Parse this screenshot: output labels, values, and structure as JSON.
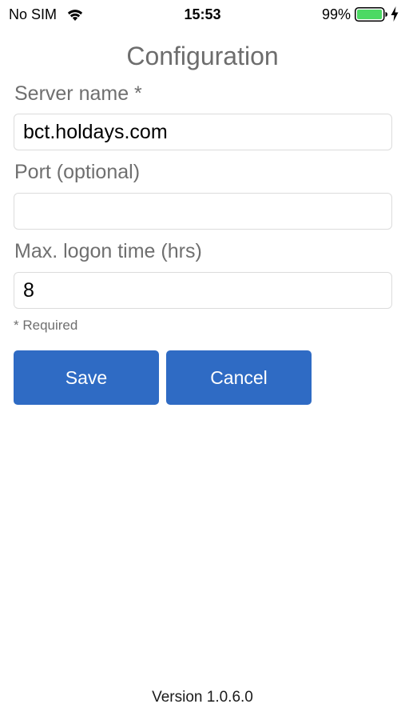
{
  "status_bar": {
    "carrier": "No SIM",
    "time": "15:53",
    "battery_percent": "99%",
    "battery_level": 0.99,
    "battery_color": "#4cd964",
    "icons": [
      "wifi-icon",
      "battery-icon",
      "charging-bolt-icon"
    ]
  },
  "title": "Configuration",
  "form": {
    "server_name": {
      "label": "Server name *",
      "value": "bct.holdays.com",
      "placeholder": ""
    },
    "port": {
      "label": "Port (optional)",
      "value": "",
      "placeholder": ""
    },
    "max_logon": {
      "label": "Max. logon time (hrs)",
      "value": "8",
      "placeholder": ""
    },
    "required_note": "* Required"
  },
  "buttons": {
    "save": "Save",
    "cancel": "Cancel",
    "color": "#2f6bc4"
  },
  "footer": {
    "version": "Version 1.0.6.0"
  }
}
